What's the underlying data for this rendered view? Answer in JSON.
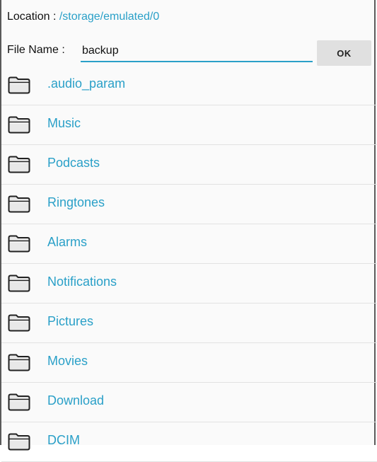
{
  "location": {
    "label": "Location : ",
    "path": "/storage/emulated/0"
  },
  "file_name": {
    "label": "File Name : ",
    "value": "backup"
  },
  "ok_button": {
    "label": "OK"
  },
  "folders": [
    {
      "name": ".audio_param"
    },
    {
      "name": "Music"
    },
    {
      "name": "Podcasts"
    },
    {
      "name": "Ringtones"
    },
    {
      "name": "Alarms"
    },
    {
      "name": "Notifications"
    },
    {
      "name": "Pictures"
    },
    {
      "name": "Movies"
    },
    {
      "name": "Download"
    },
    {
      "name": "DCIM"
    }
  ],
  "colors": {
    "accent": "#2aa0c8",
    "folder_icon": "#e8e8e8"
  }
}
